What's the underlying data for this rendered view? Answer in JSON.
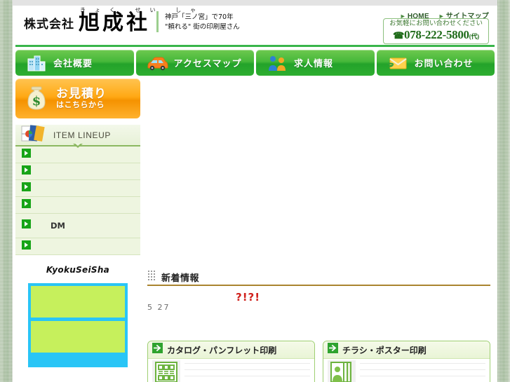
{
  "header": {
    "company_prefix": "株式会社",
    "company_name": "旭成社",
    "furigana": "きょく せい しゃ",
    "tagline_line1": "神戸「三ノ宮」で70年",
    "tagline_line2": "\"頼れる\" 街の印刷屋さん",
    "util_links": [
      {
        "label": "HOME",
        "icon": "triangle-right-icon"
      },
      {
        "label": "サイトマップ",
        "icon": "triangle-right-icon"
      }
    ],
    "phone": {
      "lead": "お気軽にお問い合わせください",
      "number": "078-222-5800",
      "suffix": "(代)",
      "icon": "telephone-icon"
    }
  },
  "nav": {
    "items": [
      {
        "label": "会社概要",
        "icon": "building-icon"
      },
      {
        "label": "アクセスマップ",
        "icon": "car-icon"
      },
      {
        "label": "求人情報",
        "icon": "people-icon"
      },
      {
        "label": "お問い合わせ",
        "icon": "envelope-icon"
      }
    ]
  },
  "sidebar": {
    "quote_banner": {
      "line1": "お見積り",
      "line2": "はこちらから",
      "icon": "money-bag-icon"
    },
    "lineup_header": {
      "label": "ITEM LINEUP",
      "icon": "documents-icon"
    },
    "menu_items": [
      {
        "label": "",
        "icon": "green-arrow-icon"
      },
      {
        "label": "",
        "icon": "green-arrow-icon"
      },
      {
        "label": "",
        "icon": "green-arrow-icon"
      },
      {
        "label": "",
        "icon": "green-arrow-icon"
      },
      {
        "label": "DM",
        "icon": "green-arrow-icon"
      },
      {
        "label": "",
        "icon": "green-arrow-icon"
      }
    ],
    "brandmark": "KyokuSeiSha"
  },
  "main": {
    "news": {
      "title": "新着情報",
      "title_icon": "dot-grid-icon",
      "entries": [
        {
          "date": "5  27",
          "text": "?!?!"
        }
      ]
    },
    "cards": [
      {
        "label": "カタログ・パンフレット印刷",
        "icon": "arrow-box-icon",
        "thumb": "catalog-grid-thumb"
      },
      {
        "label": "チラシ・ポスター印刷",
        "icon": "arrow-box-icon",
        "thumb": "person-poster-thumb"
      }
    ]
  },
  "colors": {
    "nav_green": "#39b54a",
    "accent_orange": "#f59200",
    "news_rule": "#a9842f",
    "alert_red": "#d0211c",
    "sidebar_bg": "#eef5e0",
    "box_cyan": "#29c5f6",
    "box_lime": "#c6f05c"
  }
}
